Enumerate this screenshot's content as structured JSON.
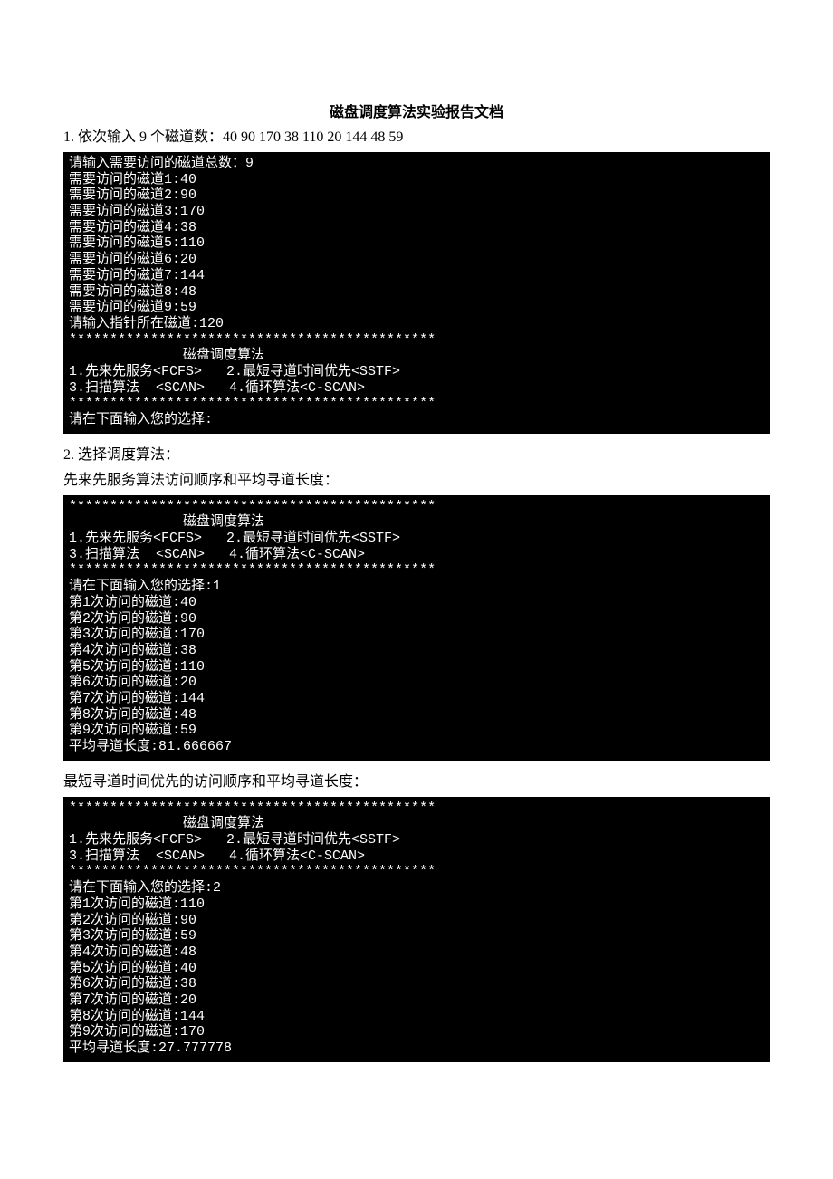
{
  "title": "磁盘调度算法实验报告文档",
  "step1_text": "1. 依次输入 9 个磁道数：40 90 170 38 110 20 144 48 59",
  "console1": "请输入需要访问的磁道总数：9\n需要访问的磁道1:40\n需要访问的磁道2:90\n需要访问的磁道3:170\n需要访问的磁道4:38\n需要访问的磁道5:110\n需要访问的磁道6:20\n需要访问的磁道7:144\n需要访问的磁道8:48\n需要访问的磁道9:59\n请输入指针所在磁道:120\n*********************************************\n              磁盘调度算法\n1.先来先服务<FCFS>   2.最短寻道时间优先<SSTF>\n3.扫描算法  <SCAN>   4.循环算法<C-SCAN>\n*********************************************\n请在下面输入您的选择:",
  "step2_text": "2. 选择调度算法：",
  "fcfs_desc": "先来先服务算法访问顺序和平均寻道长度：",
  "console2": "*********************************************\n              磁盘调度算法\n1.先来先服务<FCFS>   2.最短寻道时间优先<SSTF>\n3.扫描算法  <SCAN>   4.循环算法<C-SCAN>\n*********************************************\n请在下面输入您的选择:1\n第1次访问的磁道:40\n第2次访问的磁道:90\n第3次访问的磁道:170\n第4次访问的磁道:38\n第5次访问的磁道:110\n第6次访问的磁道:20\n第7次访问的磁道:144\n第8次访问的磁道:48\n第9次访问的磁道:59\n平均寻道长度:81.666667",
  "sstf_desc": "最短寻道时间优先的访问顺序和平均寻道长度：",
  "console3": "*********************************************\n              磁盘调度算法\n1.先来先服务<FCFS>   2.最短寻道时间优先<SSTF>\n3.扫描算法  <SCAN>   4.循环算法<C-SCAN>\n*********************************************\n请在下面输入您的选择:2\n第1次访问的磁道:110\n第2次访问的磁道:90\n第3次访问的磁道:59\n第4次访问的磁道:48\n第5次访问的磁道:40\n第6次访问的磁道:38\n第7次访问的磁道:20\n第8次访问的磁道:144\n第9次访问的磁道:170\n平均寻道长度:27.777778"
}
